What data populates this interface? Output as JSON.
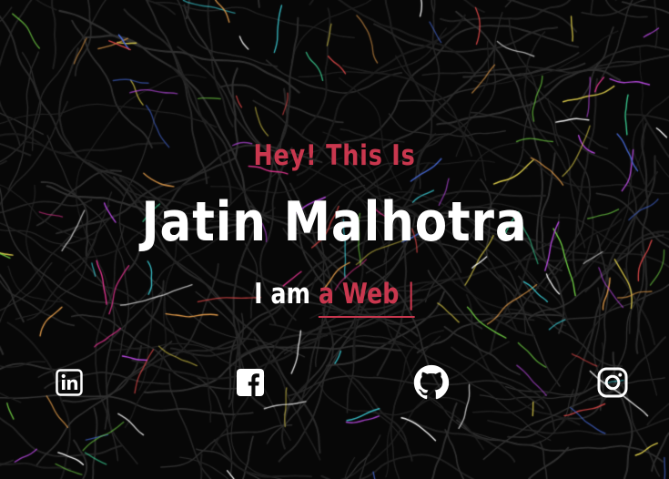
{
  "hero": {
    "greeting": "Hey! This Is",
    "name": "Jatin Malhotra",
    "typed_prefix": "I am ",
    "typed_text": "a Web ",
    "cursor": "|"
  },
  "social": [
    {
      "icon": "linkedin-icon"
    },
    {
      "icon": "facebook-icon"
    },
    {
      "icon": "github-icon"
    },
    {
      "icon": "instagram-icon"
    }
  ],
  "colors": {
    "accent": "#c9374e",
    "background": "#070707",
    "text": "#ffffff"
  }
}
